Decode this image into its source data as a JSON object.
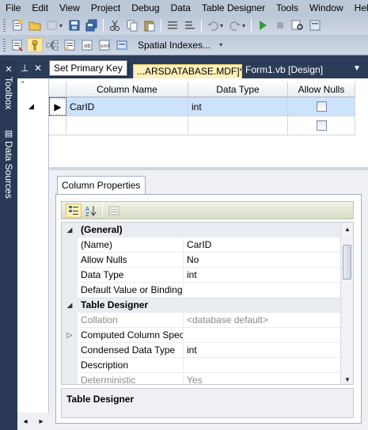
{
  "menu": [
    "File",
    "Edit",
    "View",
    "Project",
    "Debug",
    "Data",
    "Table Designer",
    "Tools",
    "Window",
    "Help"
  ],
  "toolbar2": {
    "spatial_label": "Spatial Indexes..."
  },
  "tooltip": "Set Primary Key",
  "sidebar": {
    "toolbox": "Toolbox",
    "data_sources": "Data Sources"
  },
  "tabs": {
    "active": "...ARSDATABASE.MDF]*",
    "second": "Form1.vb [Design]"
  },
  "grid": {
    "headers": {
      "name": "Column Name",
      "type": "Data Type",
      "nulls": "Allow Nulls"
    },
    "rows": [
      {
        "name": "CarID",
        "type": "int",
        "allow_nulls": false
      },
      {
        "name": "",
        "type": "",
        "allow_nulls": false
      }
    ]
  },
  "column_properties": {
    "tab_label": "Column Properties",
    "rows": [
      {
        "kind": "category",
        "name": "(General)"
      },
      {
        "name": "(Name)",
        "value": "CarID"
      },
      {
        "name": "Allow Nulls",
        "value": "No"
      },
      {
        "name": "Data Type",
        "value": "int"
      },
      {
        "name": "Default Value or Binding",
        "value": ""
      },
      {
        "kind": "category",
        "name": "Table Designer"
      },
      {
        "name": "Collation",
        "value": "<database default>",
        "dim": true
      },
      {
        "name": "Computed Column Spec",
        "value": "",
        "expandable": true
      },
      {
        "name": "Condensed Data Type",
        "value": "int"
      },
      {
        "name": "Description",
        "value": ""
      },
      {
        "name": "Deterministic",
        "value": "Yes",
        "dim": true
      }
    ],
    "description_title": "Table Designer"
  }
}
